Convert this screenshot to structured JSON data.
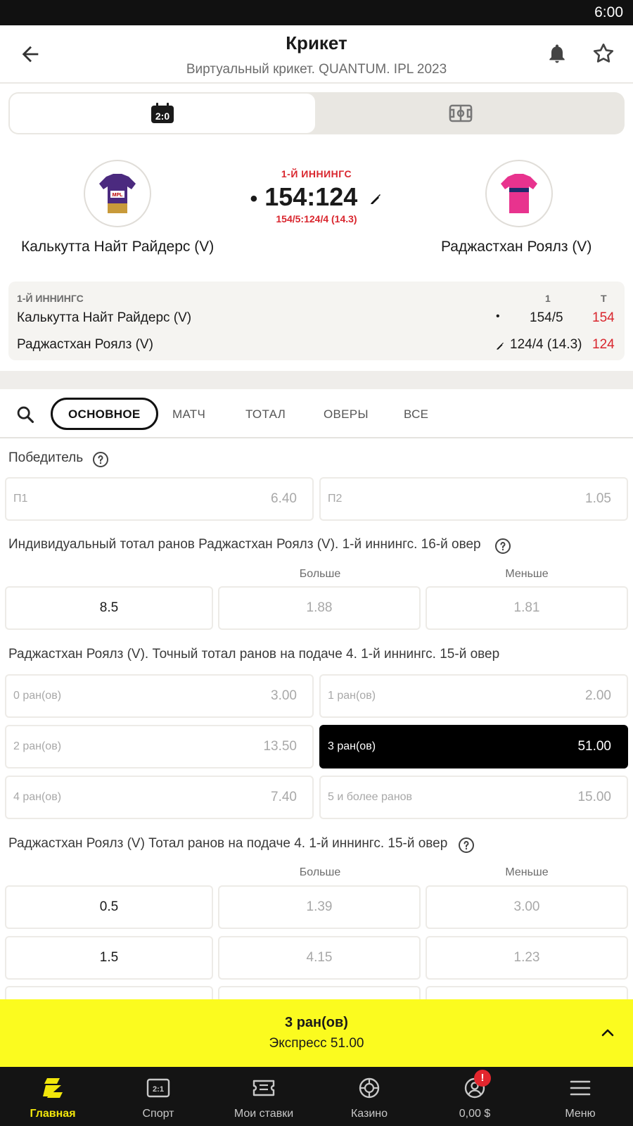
{
  "status_bar": {
    "time": "6:00"
  },
  "header": {
    "title": "Крикет",
    "subtitle": "Виртуальный крикет. QUANTUM. IPL 2023",
    "back_icon": "arrow-left-icon",
    "bell_icon": "bell-icon",
    "star_icon": "star-icon"
  },
  "segmented": {
    "tabs": [
      {
        "icon": "scoreboard-icon",
        "active": true
      },
      {
        "icon": "field-icon",
        "active": false
      }
    ]
  },
  "match": {
    "home": {
      "name": "Калькутта Найт Райдерс (V)",
      "jersey_color": "#4b2a7f"
    },
    "away": {
      "name": "Раджастхан Роялз (V)",
      "jersey_color": "#e8338e"
    },
    "inning_label": "1-Й ИННИНГС",
    "score": "154:124",
    "sub_score": "154/5:124/4 (14.3)"
  },
  "scoreboard": {
    "inning_header": "1-Й ИННИНГС",
    "col1": "1",
    "col2": "Т",
    "rows": [
      {
        "team": "Калькутта Найт Райдерс (V)",
        "score": "154/5",
        "total": "154"
      },
      {
        "team": "Раджастхан Роялз (V)",
        "score": "124/4 (14.3)",
        "total": "124"
      }
    ]
  },
  "tabs": {
    "items": [
      "ОСНОВНОЕ",
      "МАТЧ",
      "ТОТАЛ",
      "ОВЕРЫ",
      "ВСЕ"
    ],
    "active_index": 0
  },
  "markets": {
    "winner": {
      "title": "Победитель",
      "outcomes": [
        {
          "label": "П1",
          "odd": "6.40"
        },
        {
          "label": "П2",
          "odd": "1.05"
        }
      ]
    },
    "individual_total": {
      "title": "Индивидуальный тотал ранов Раджастхан Роялз (V). 1-й иннингс. 16-й овер",
      "col_over": "Больше",
      "col_under": "Меньше",
      "rows": [
        {
          "line": "8.5",
          "over": "1.88",
          "under": "1.81"
        }
      ]
    },
    "exact_total": {
      "title": "Раджастхан Роялз (V). Точный тотал ранов на подаче 4. 1-й иннингс. 15-й овер",
      "outcomes": [
        {
          "label": "0 ран(ов)",
          "odd": "3.00"
        },
        {
          "label": "1 ран(ов)",
          "odd": "2.00"
        },
        {
          "label": "2 ран(ов)",
          "odd": "13.50"
        },
        {
          "label": "3 ран(ов)",
          "odd": "51.00",
          "selected": true
        },
        {
          "label": "4 ран(ов)",
          "odd": "7.40"
        },
        {
          "label": "5 и более ранов",
          "odd": "15.00"
        }
      ]
    },
    "delivery_total": {
      "title": "Раджастхан Роялз (V) Тотал ранов на подаче 4. 1-й иннингс. 15-й овер",
      "col_over": "Больше",
      "col_under": "Меньше",
      "rows": [
        {
          "line": "0.5",
          "over": "1.39",
          "under": "3.00"
        },
        {
          "line": "1.5",
          "over": "4.15",
          "under": "1.23"
        }
      ]
    }
  },
  "bet_slip": {
    "selection": "3 ран(ов)",
    "summary": "Экспресс 51.00",
    "chevron_icon": "chevron-up-icon"
  },
  "bottom_nav": {
    "items": [
      {
        "label": "Главная",
        "icon": "home-logo-icon",
        "active": true
      },
      {
        "label": "Спорт",
        "icon": "sport-icon"
      },
      {
        "label": "Мои ставки",
        "icon": "ticket-icon"
      },
      {
        "label": "Казино",
        "icon": "casino-chip-icon"
      },
      {
        "label": "0,00 $",
        "icon": "account-icon",
        "badge": "!"
      },
      {
        "label": "Меню",
        "icon": "menu-icon"
      }
    ]
  },
  "colors": {
    "accent_yellow": "#fbfb1f",
    "score_red": "#d9262e",
    "nav_active": "#f2e60b"
  }
}
